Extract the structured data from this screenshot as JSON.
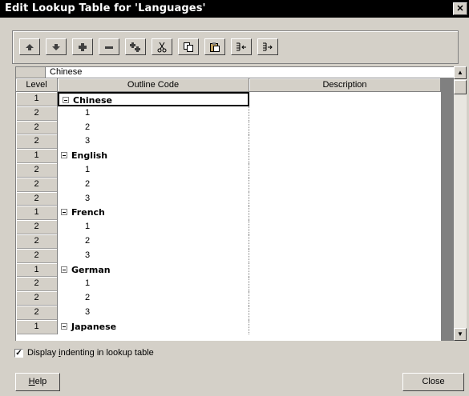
{
  "window": {
    "title": "Edit Lookup Table for 'Languages'",
    "close_glyph": "✕"
  },
  "toolbar": {
    "buttons": [
      {
        "icon": "move-up-icon"
      },
      {
        "icon": "move-down-icon"
      },
      {
        "icon": "indent-icon"
      },
      {
        "icon": "outdent-icon"
      },
      {
        "icon": "insert-row-icon"
      },
      {
        "icon": "cut-icon"
      },
      {
        "icon": "copy-icon"
      },
      {
        "icon": "paste-icon"
      },
      {
        "icon": "import-icon"
      },
      {
        "icon": "export-icon"
      }
    ]
  },
  "edit": {
    "value": "Chinese"
  },
  "grid": {
    "columns": {
      "level": "Level",
      "code": "Outline Code",
      "description": "Description"
    },
    "rows": [
      {
        "level": "1",
        "code": "Chinese",
        "top": true,
        "selected": true
      },
      {
        "level": "2",
        "code": "1"
      },
      {
        "level": "2",
        "code": "2"
      },
      {
        "level": "2",
        "code": "3"
      },
      {
        "level": "1",
        "code": "English",
        "top": true
      },
      {
        "level": "2",
        "code": "1"
      },
      {
        "level": "2",
        "code": "2"
      },
      {
        "level": "2",
        "code": "3"
      },
      {
        "level": "1",
        "code": "French",
        "top": true
      },
      {
        "level": "2",
        "code": "1"
      },
      {
        "level": "2",
        "code": "2"
      },
      {
        "level": "2",
        "code": "3"
      },
      {
        "level": "1",
        "code": "German",
        "top": true
      },
      {
        "level": "2",
        "code": "1"
      },
      {
        "level": "2",
        "code": "2"
      },
      {
        "level": "2",
        "code": "3"
      },
      {
        "level": "1",
        "code": "Japanese",
        "top": true
      }
    ]
  },
  "options": {
    "display_indenting": {
      "checked": true,
      "label_pre": "Display ",
      "label_u": "i",
      "label_post": "ndenting in lookup table"
    }
  },
  "footer": {
    "help_pre": "",
    "help_u": "H",
    "help_post": "elp",
    "close": "Close"
  },
  "colors": {
    "titlebar": "#000000",
    "dialog": "#d4d0c8",
    "grid_band": "#808080"
  }
}
